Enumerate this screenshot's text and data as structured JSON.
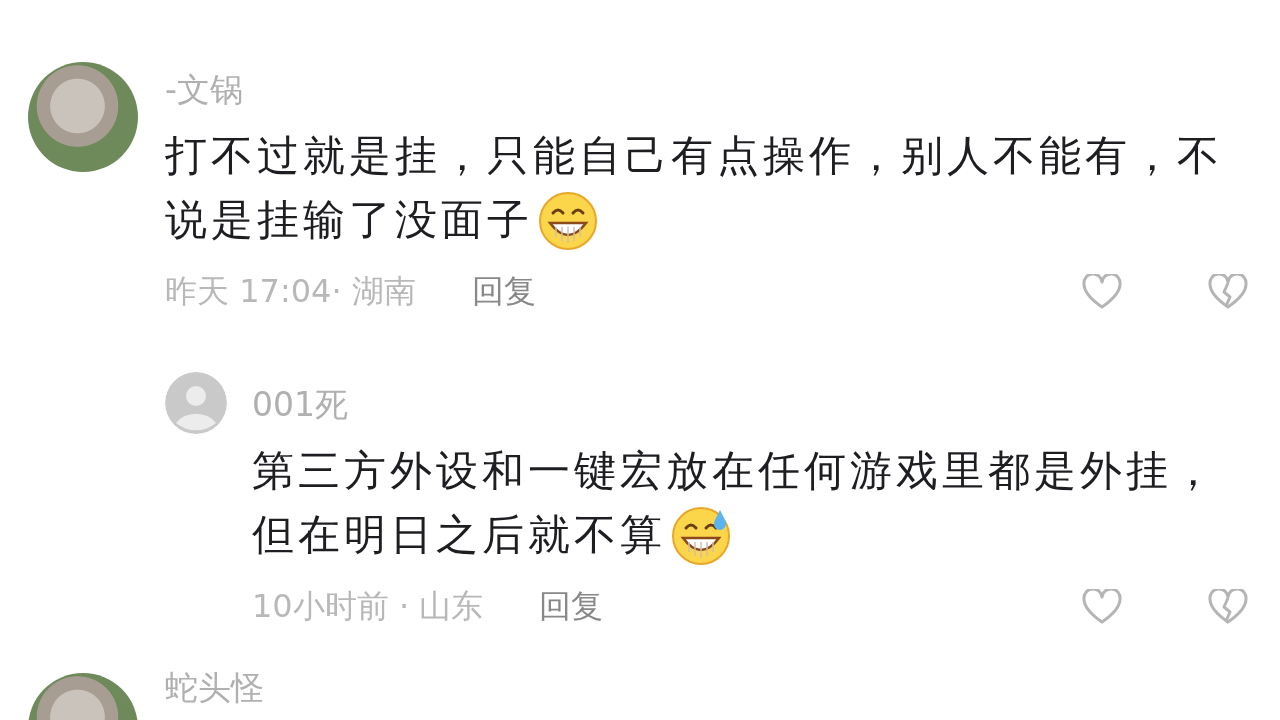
{
  "comments": [
    {
      "avatar": {
        "kind": "photo"
      },
      "name": "-文锅",
      "text_lines": [
        "打不过就是挂，只能自己有点操作，别人不能有，不",
        "说是挂输了没面子"
      ],
      "emoji": {
        "kind": "grin"
      },
      "time": "昨天 17:04· 湖南",
      "reply_label": "回复",
      "replies": [
        {
          "avatar": {
            "kind": "default"
          },
          "name": "001死",
          "text_lines": [
            "第三方外设和一键宏放在任何游戏里都是外挂，",
            "但在明日之后就不算"
          ],
          "emoji": {
            "kind": "grin_sweat"
          },
          "time": "10小时前 · 山东",
          "reply_label": "回复"
        }
      ]
    },
    {
      "avatar": {
        "kind": "photo"
      },
      "name": "蛇头怪"
    }
  ]
}
